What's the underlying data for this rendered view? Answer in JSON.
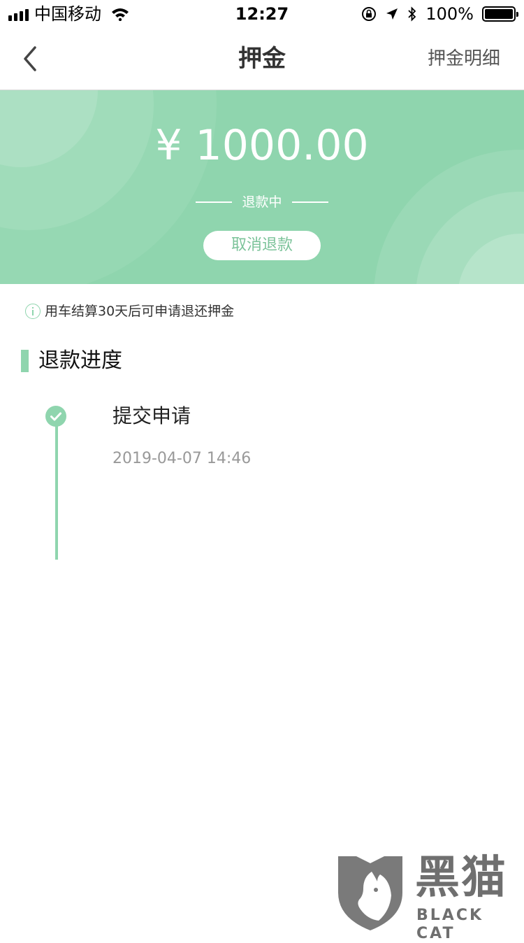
{
  "status_bar": {
    "carrier": "中国移动",
    "time": "12:27",
    "battery_percent": "100%"
  },
  "nav": {
    "title": "押金",
    "right_link": "押金明细"
  },
  "deposit": {
    "amount": "¥ 1000.00",
    "status": "退款中",
    "cancel_button": "取消退款"
  },
  "info_note": "用车结算30天后可申请退还押金",
  "progress": {
    "section_title": "退款进度",
    "steps": [
      {
        "title": "提交申请",
        "time": "2019-04-07 14:46"
      }
    ]
  },
  "watermark": {
    "cn": "黑猫",
    "en": "BLACK CAT"
  },
  "colors": {
    "accent": "#8fd5ae",
    "accent_text": "#7cc39a"
  }
}
